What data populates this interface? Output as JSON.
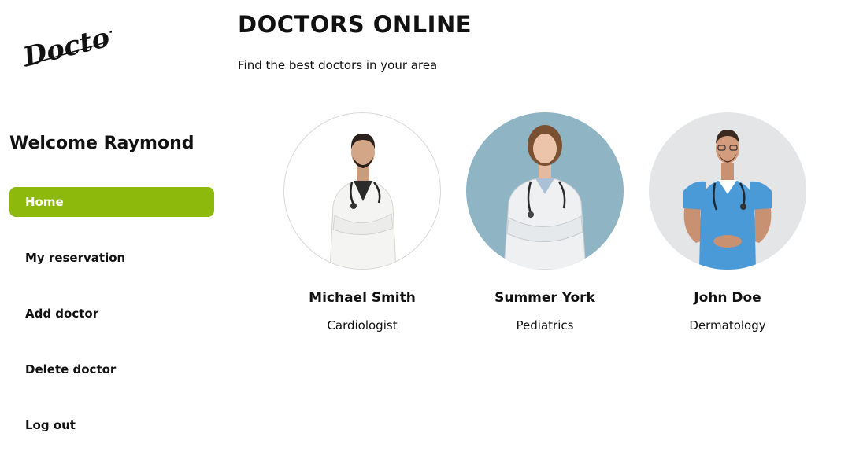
{
  "sidebar": {
    "logo_text": "Doctors",
    "welcome": "Welcome Raymond",
    "nav": [
      {
        "label": "Home",
        "active": true
      },
      {
        "label": "My reservation",
        "active": false
      },
      {
        "label": "Add doctor",
        "active": false
      },
      {
        "label": "Delete doctor",
        "active": false
      },
      {
        "label": "Log out",
        "active": false
      }
    ]
  },
  "header": {
    "title": "DOCTORS ONLINE",
    "subtitle": "Find the best doctors in your area"
  },
  "doctors": [
    {
      "name": "Michael Smith",
      "specialty": "Cardiologist",
      "background": "#ffffff",
      "outfit": "white-coat"
    },
    {
      "name": "Summer York",
      "specialty": "Pediatrics",
      "background": "#8fb4c4",
      "outfit": "white-coat"
    },
    {
      "name": "John Doe",
      "specialty": "Dermatology",
      "background": "#e4e5e7",
      "outfit": "blue-scrubs"
    }
  ],
  "colors": {
    "accent": "#8cb90b",
    "text": "#111111"
  }
}
